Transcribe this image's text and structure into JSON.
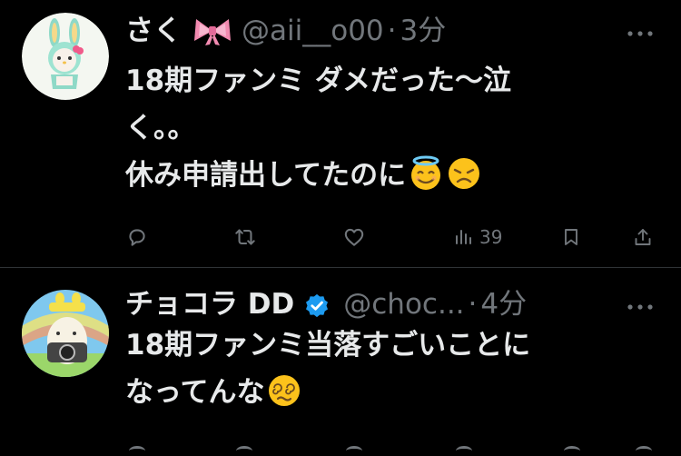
{
  "tweets": [
    {
      "display_name": "さく",
      "handle": "@aii__o00",
      "separator": "·",
      "time": "3分",
      "lines": [
        "18期ファンミ ダメだった〜泣",
        "く。。",
        "休み申請出してたのに"
      ],
      "name_emoji": "ribbon-emoji",
      "body_emojis": [
        "halo-smile-emoji",
        "disappointed-emoji"
      ],
      "stats": {
        "views": "39"
      }
    },
    {
      "display_name": "チョコラ DD",
      "handle": "@choc...",
      "separator": "·",
      "time": "4分",
      "lines": [
        "18期ファンミ当落すごいことに",
        "なってんな"
      ],
      "body_emojis": [
        "dizzy-face-emoji"
      ],
      "verified": true
    }
  ],
  "colors": {
    "background": "#000000",
    "text": "#e7e9ea",
    "secondary": "#71767b",
    "verified": "#1d9bf0",
    "divider": "#2f3336"
  },
  "icons": [
    "reply-icon",
    "retweet-icon",
    "like-icon",
    "views-icon",
    "bookmark-icon",
    "share-icon",
    "more-icon"
  ]
}
